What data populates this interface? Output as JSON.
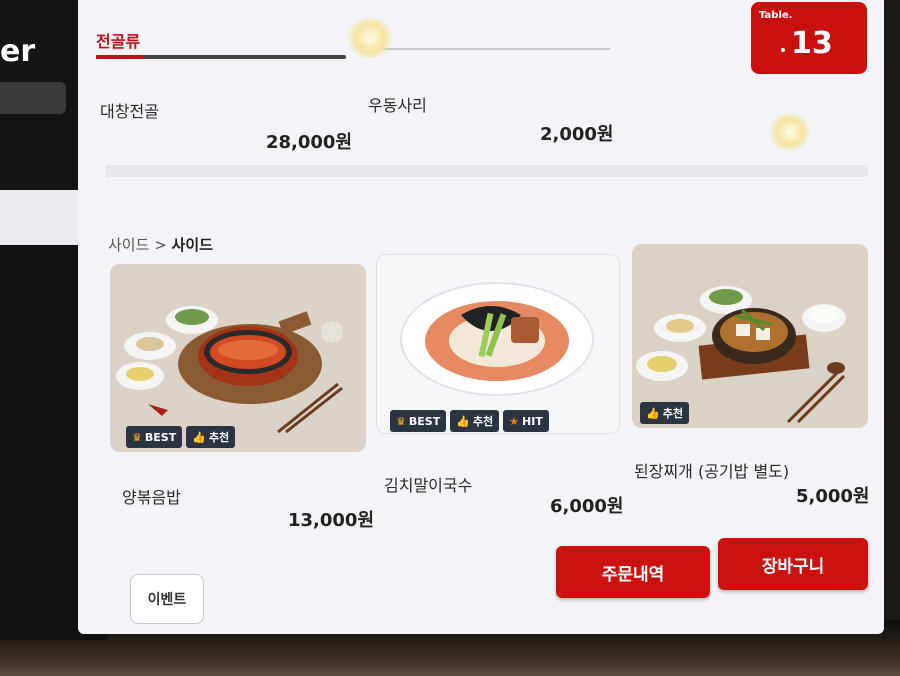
{
  "left_panel": {
    "logo_text": "er"
  },
  "tabs": [
    {
      "label": "전골류",
      "active": true
    }
  ],
  "table": {
    "label": "Table.",
    "number": "13"
  },
  "top_items": [
    {
      "name": "대창전골",
      "price": "28,000원"
    },
    {
      "name": "우동사리",
      "price": "2,000원"
    }
  ],
  "breadcrumb": {
    "parent": "사이드",
    "separator": ">",
    "current": "사이드"
  },
  "cards": [
    {
      "name": "양볶음밥",
      "price": "13,000원",
      "badges": [
        "BEST",
        "추천"
      ]
    },
    {
      "name": "김치말이국수",
      "price": "6,000원",
      "badges": [
        "BEST",
        "추천",
        "HIT"
      ]
    },
    {
      "name": "된장찌개 (공기밥 별도)",
      "price": "5,000원",
      "badges": [
        "추천"
      ]
    }
  ],
  "buttons": {
    "event": "이벤트",
    "order_history": "주문내역",
    "cart": "장바구니"
  },
  "colors": {
    "accent": "#cc1211",
    "badge_bg": "#2d3441",
    "screen_bg": "#f3f4f8"
  }
}
